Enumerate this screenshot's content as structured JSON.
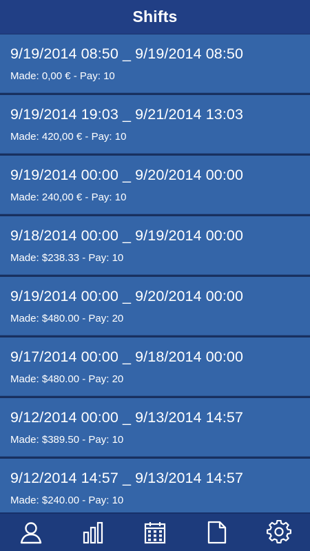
{
  "header": {
    "title": "Shifts"
  },
  "shifts": [
    {
      "range": "9/19/2014 08:50 _ 9/19/2014 08:50",
      "summary": "Made: 0,00 € - Pay: 10"
    },
    {
      "range": "9/19/2014 19:03 _ 9/21/2014 13:03",
      "summary": "Made: 420,00 € - Pay: 10"
    },
    {
      "range": "9/19/2014 00:00 _ 9/20/2014 00:00",
      "summary": "Made: 240,00 € - Pay: 10"
    },
    {
      "range": "9/18/2014 00:00 _ 9/19/2014 00:00",
      "summary": "Made: $238.33 - Pay: 10"
    },
    {
      "range": "9/19/2014 00:00 _ 9/20/2014 00:00",
      "summary": "Made: $480.00 - Pay: 20"
    },
    {
      "range": "9/17/2014 00:00 _ 9/18/2014 00:00",
      "summary": "Made: $480.00 - Pay: 20"
    },
    {
      "range": "9/12/2014 00:00 _ 9/13/2014 14:57",
      "summary": "Made: $389.50 - Pay: 10"
    },
    {
      "range": "9/12/2014 14:57 _ 9/13/2014 14:57",
      "summary": "Made: $240.00 - Pay: 10"
    }
  ],
  "tabbar": {
    "tabs": [
      {
        "icon": "user-icon"
      },
      {
        "icon": "bar-chart-icon"
      },
      {
        "icon": "calendar-icon"
      },
      {
        "icon": "document-icon"
      },
      {
        "icon": "gear-icon"
      }
    ]
  },
  "colors": {
    "header_bg": "#213f85",
    "item_bg": "#3465a8",
    "separator": "#18305f",
    "tabbar_bg": "#1d3b7c",
    "text": "#ffffff"
  }
}
